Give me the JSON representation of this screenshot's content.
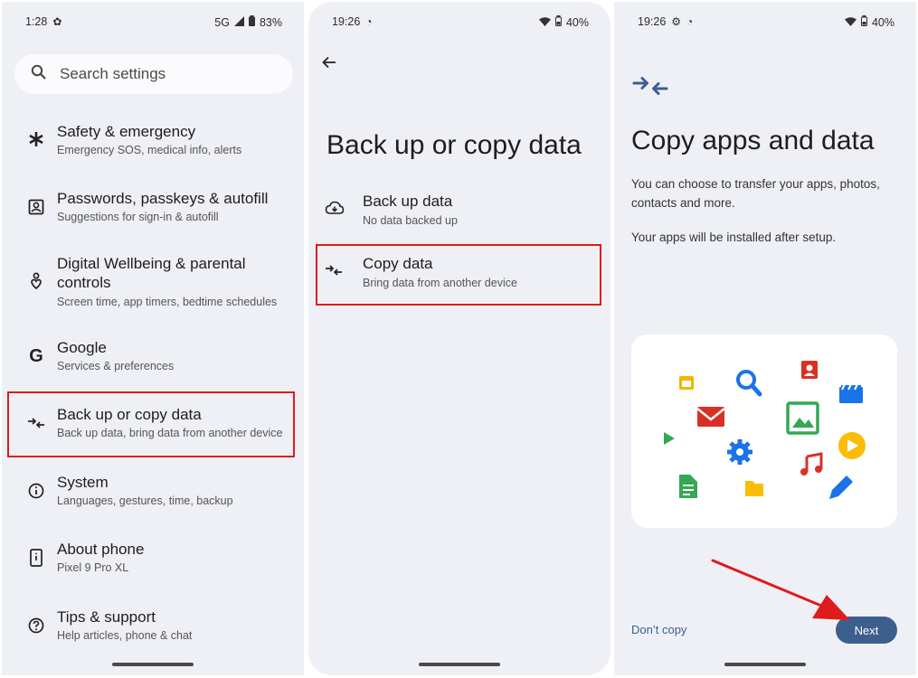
{
  "panel1": {
    "status": {
      "time": "1:28",
      "network": "5G",
      "battery": "83%"
    },
    "search_placeholder": "Search settings",
    "items": [
      {
        "icon": "asterisk-icon",
        "title": "Safety & emergency",
        "subtitle": "Emergency SOS, medical info, alerts"
      },
      {
        "icon": "person-badge-icon",
        "title": "Passwords, passkeys & autofill",
        "subtitle": "Suggestions for sign-in & autofill"
      },
      {
        "icon": "wellbeing-icon",
        "title": "Digital Wellbeing & parental controls",
        "subtitle": "Screen time, app timers, bedtime schedules"
      },
      {
        "icon": "google-icon",
        "title": "Google",
        "subtitle": "Services & preferences"
      },
      {
        "icon": "transfer-icon",
        "title": "Back up or copy data",
        "subtitle": "Back up data, bring data from another device"
      },
      {
        "icon": "info-icon",
        "title": "System",
        "subtitle": "Languages, gestures, time, backup"
      },
      {
        "icon": "phone-icon",
        "title": "About phone",
        "subtitle": "Pixel 9 Pro XL"
      },
      {
        "icon": "help-icon",
        "title": "Tips & support",
        "subtitle": "Help articles, phone & chat"
      }
    ]
  },
  "panel2": {
    "status": {
      "time": "19:26",
      "battery": "40%"
    },
    "title": "Back up or copy data",
    "options": [
      {
        "icon": "cloud-backup-icon",
        "title": "Back up data",
        "subtitle": "No data backed up"
      },
      {
        "icon": "transfer-icon",
        "title": "Copy data",
        "subtitle": "Bring data from another device"
      }
    ]
  },
  "panel3": {
    "status": {
      "time": "19:26",
      "battery": "40%"
    },
    "title": "Copy apps and data",
    "body1": "You can choose to transfer your apps, photos, contacts and more.",
    "body2": "Your apps will be installed after setup.",
    "dont_copy": "Don’t copy",
    "next": "Next"
  },
  "colors": {
    "highlight": "#e01b1b",
    "accent": "#3d5f8e",
    "panel_bg": "#eff0f6"
  }
}
